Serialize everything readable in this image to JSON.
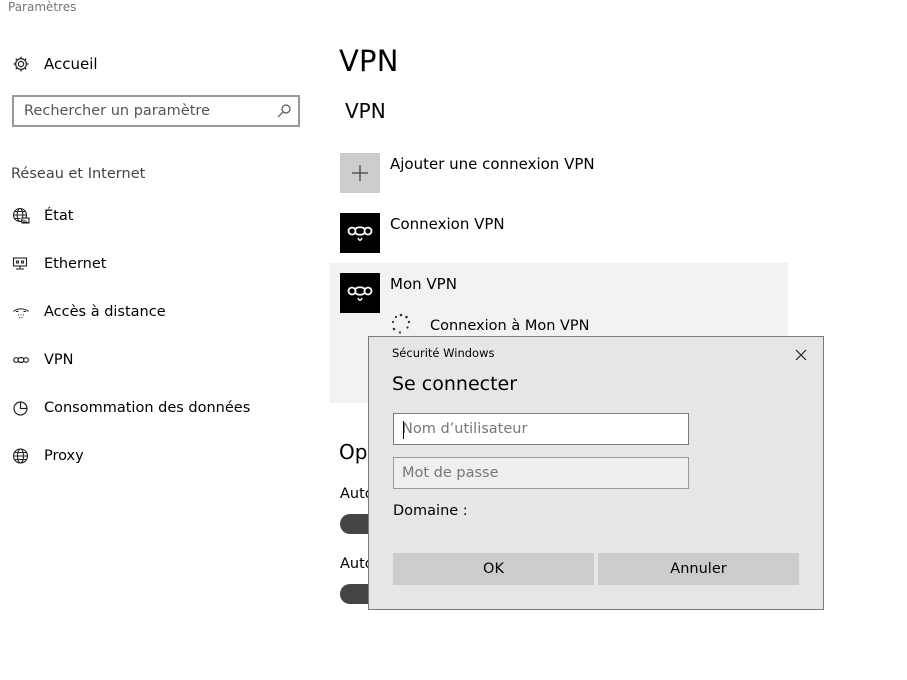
{
  "window": {
    "title": "Paramètres"
  },
  "sidebar": {
    "home_label": "Accueil",
    "search_placeholder": "Rechercher un paramètre",
    "section_title": "Réseau et Internet",
    "items": [
      {
        "label": "État",
        "icon": "globe-status-icon"
      },
      {
        "label": "Ethernet",
        "icon": "ethernet-icon"
      },
      {
        "label": "Accès à distance",
        "icon": "dialup-icon"
      },
      {
        "label": "VPN",
        "icon": "vpn-icon"
      },
      {
        "label": "Consommation des données",
        "icon": "data-usage-icon"
      },
      {
        "label": "Proxy",
        "icon": "globe-icon"
      }
    ]
  },
  "main": {
    "title": "VPN",
    "subtitle": "VPN",
    "add_label": "Ajouter une connexion VPN",
    "connections": [
      {
        "name": "Connexion VPN"
      },
      {
        "name": "Mon VPN"
      }
    ],
    "connecting_text": "Connexion à Mon VPN",
    "options_title": "Opt",
    "option_labels": [
      "Auto",
      "Auto"
    ]
  },
  "dialog": {
    "title": "Sécurité Windows",
    "heading": "Se connecter",
    "username_placeholder": "Nom d’utilisateur",
    "password_placeholder": "Mot de passe",
    "domain_label": "Domaine :",
    "ok_label": "OK",
    "cancel_label": "Annuler"
  },
  "colors": {
    "tile_dark": "#000000",
    "tile_add": "#cccccc",
    "selected_bg": "#f2f2f2",
    "dialog_bg": "#e6e6e6"
  }
}
